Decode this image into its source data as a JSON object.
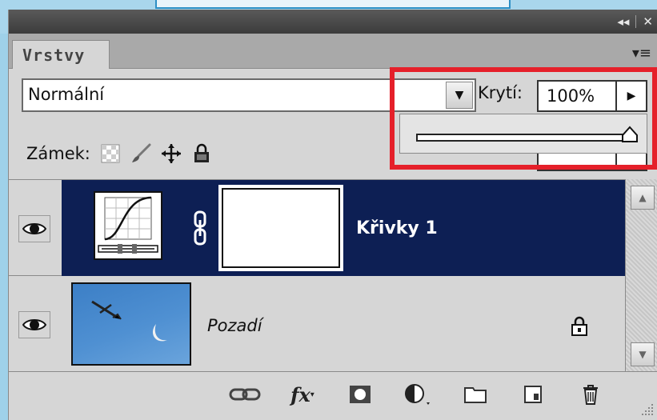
{
  "panel": {
    "tab_label": "Vrstvy",
    "collapse_label": "◂◂",
    "close_label": "✕"
  },
  "blend_mode": {
    "value": "Normální"
  },
  "opacity": {
    "label": "Krytí:",
    "value": "100%",
    "slider_fraction": 1.0
  },
  "lock": {
    "label": "Zámek:"
  },
  "layers": [
    {
      "name": "Křivky 1",
      "type": "adjustment-curves",
      "visible": true,
      "selected": true
    },
    {
      "name": "Pozadí",
      "type": "background",
      "visible": true,
      "locked": true
    }
  ],
  "colors": {
    "selection": "#0d1f54",
    "highlight": "#e5202a",
    "panel_bg": "#d6d6d6"
  }
}
